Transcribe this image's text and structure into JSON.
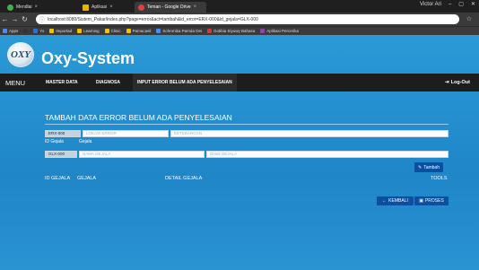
{
  "browser": {
    "tabs": [
      {
        "label": "Mendlai",
        "color": "#3bb54a"
      },
      {
        "label": "Aplikasi",
        "color": "#e6b400"
      },
      {
        "label": "Teman - Google Drive",
        "color": "#e04040"
      }
    ],
    "user": "Victor Ari",
    "url": "localhost:8080/Sistem_Pakar/index.php?page=error&act=tambah&id_error=ERX-000&id_gejala=GLX-000",
    "bookmarks": [
      "Apps",
      "Yo",
      "Importad",
      "Learning",
      "Clinic",
      "Pamacasil",
      "Schronika Pamda Dei",
      "Gotibia Siyuwy Bahasa",
      "Aplikasi Percerika"
    ]
  },
  "app": {
    "brand": "Oxy-System",
    "logo_text": "OXY",
    "menu_label": "MENU",
    "nav": [
      "MASTER DATA",
      "DIAGNOSA",
      "INPUT ERROR BELUM ADA PENYELESAIAN"
    ],
    "logout": "Log-Out",
    "heading": "TAMBAH DATA ERROR BELUM ADA PENYELESAIAN",
    "form": {
      "error_id_value": "ERX-000",
      "lokasi_placeholder": "LOKASI ERROR",
      "keterangan_placeholder": "KETERANGAN",
      "label_id_gejala": "ID Gejala",
      "label_gejala": "Gejala",
      "gejala_id_value": "GLX-000",
      "nama_gejala_placeholder": "NAMA GEJALA",
      "detail_gejala_placeholder": "Detail GEJALA"
    },
    "tambah_button": "Tambah",
    "table_headers": {
      "id_gejala": "ID GEJALA",
      "gejala": "GEJALA",
      "detail": "DETAIL GEJALA",
      "tools": "TOOLS"
    },
    "kembali_button": "KEMBALI",
    "proses_button": "PROSES"
  }
}
